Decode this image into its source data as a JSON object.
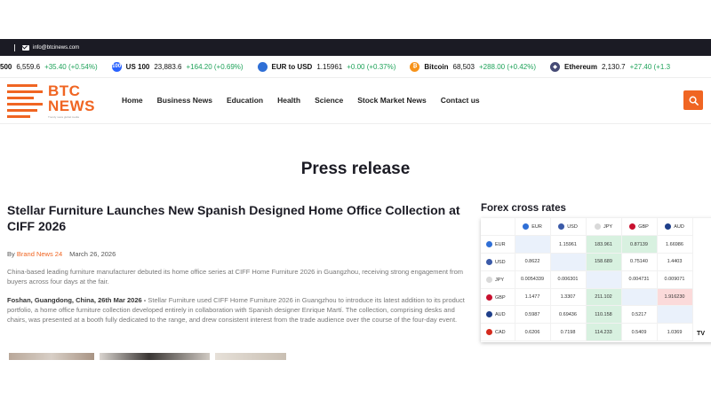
{
  "topbar": {
    "email": "info@btcinews.com"
  },
  "ticker": [
    {
      "name": "500",
      "price": "6,559.6",
      "change": "+35.40 (+0.54%)",
      "icon_color": "",
      "icon": ""
    },
    {
      "name": "US 100",
      "price": "23,883.6",
      "change": "+164.20 (+0.69%)",
      "icon_color": "#2962ff",
      "icon": "100"
    },
    {
      "name": "EUR to USD",
      "price": "1.15961",
      "change": "+0.00 (+0.37%)",
      "icon_color": "#2f6fd6",
      "icon": "eu-flag-icon"
    },
    {
      "name": "Bitcoin",
      "price": "68,503",
      "change": "+288.00 (+0.42%)",
      "icon_color": "#f7931a",
      "icon": "₿"
    },
    {
      "name": "Ethereum",
      "price": "2,130.7",
      "change": "+27.40 (+1.3",
      "icon_color": "#454a75",
      "icon": "◆"
    }
  ],
  "logo": {
    "line1": "BTC",
    "line2": "NEWS",
    "tagline": "Trendy news global media"
  },
  "nav": [
    "Home",
    "Business News",
    "Education",
    "Health",
    "Science",
    "Stock Market News",
    "Contact us"
  ],
  "page_title": "Press release",
  "article": {
    "title": "Stellar Furniture Launches New Spanish Designed Home Office Collection at CIFF 2026",
    "by": "By",
    "author": "Brand News 24",
    "date": "March 26, 2026",
    "para1": "China-based leading furniture manufacturer debuted its home office series at CIFF Home Furniture 2026 in Guangzhou, receiving strong engagement from buyers across four days at the fair.",
    "para2_lead": "Foshan, Guangdong, China, 26th Mar 2026 -",
    "para2": " Stellar Furniture used CIFF Home Furniture 2026 in Guangzhou to introduce its latest addition to its product portfolio, a home office furniture collection developed entirely in collaboration with Spanish designer Enrique Martí. The collection, comprising desks and chairs, was presented at a booth fully dedicated to the range, and drew consistent interest from the trade audience over the course of the four-day event."
  },
  "forex": {
    "title": "Forex cross rates",
    "columns": [
      {
        "code": "EUR",
        "color": "#2f6fd6"
      },
      {
        "code": "USD",
        "color": "#3b5aa8"
      },
      {
        "code": "JPY",
        "color": "#d9d9d9"
      },
      {
        "code": "GBP",
        "color": "#c8102e"
      },
      {
        "code": "AUD",
        "color": "#1f3f8a"
      }
    ],
    "rows": [
      {
        "code": "EUR",
        "color": "#2f6fd6",
        "cells": [
          "",
          "1.15961",
          "183.961",
          "0.87139",
          "1.66986"
        ],
        "shade": [
          "empty",
          "",
          "up",
          "up",
          ""
        ]
      },
      {
        "code": "USD",
        "color": "#3b5aa8",
        "cells": [
          "0.8622",
          "",
          "158.689",
          "0.75140",
          "1.4403"
        ],
        "shade": [
          "",
          "empty",
          "up",
          "",
          ""
        ]
      },
      {
        "code": "JPY",
        "color": "#d9d9d9",
        "cells": [
          "0.0054339",
          "0.006301",
          "",
          "0.004731",
          "0.009071"
        ],
        "shade": [
          "",
          "",
          "empty",
          "",
          ""
        ]
      },
      {
        "code": "GBP",
        "color": "#c8102e",
        "cells": [
          "1.1477",
          "1.3307",
          "211.102",
          "",
          "1.916230"
        ],
        "shade": [
          "",
          "",
          "up",
          "empty",
          "down"
        ]
      },
      {
        "code": "AUD",
        "color": "#1f3f8a",
        "cells": [
          "0.5987",
          "0.69436",
          "110.158",
          "0.5217",
          ""
        ],
        "shade": [
          "",
          "",
          "up",
          "",
          "empty"
        ]
      },
      {
        "code": "CAD",
        "color": "#d52b1e",
        "cells": [
          "0.6206",
          "0.7198",
          "114.233",
          "0.5409",
          "1.0369"
        ],
        "shade": [
          "",
          "",
          "up",
          "",
          ""
        ]
      }
    ],
    "brand": "TV"
  }
}
